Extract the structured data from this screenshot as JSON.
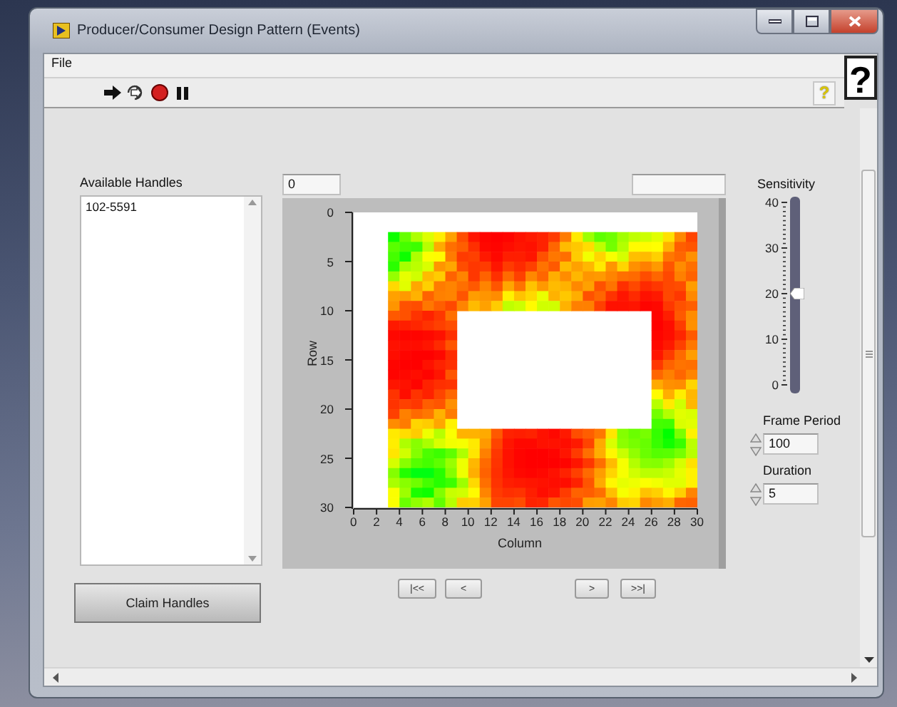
{
  "window": {
    "title": "Producer/Consumer Design Pattern (Events)"
  },
  "menu": [
    {
      "label": "File"
    }
  ],
  "toolbar": {
    "help_glyph": "?"
  },
  "context_help": {
    "glyph": "?"
  },
  "handles": {
    "label": "Available Handles",
    "items": [
      "102-5591"
    ],
    "button": "Claim Handles"
  },
  "frame_index": {
    "value": "0"
  },
  "graph": {
    "ylabel": "Row",
    "xlabel": "Column",
    "yticks": [
      "0",
      "5",
      "10",
      "15",
      "20",
      "25",
      "30"
    ],
    "xticks": [
      "0",
      "2",
      "4",
      "6",
      "8",
      "10",
      "12",
      "14",
      "16",
      "18",
      "20",
      "22",
      "24",
      "26",
      "28",
      "30"
    ]
  },
  "nav_buttons": [
    "|<<",
    "<",
    ">",
    ">>|"
  ],
  "sensitivity": {
    "label": "Sensitivity",
    "level": 0.5,
    "ticks": [
      "40",
      "30",
      "20",
      "10",
      "0"
    ]
  },
  "frame_period": {
    "label": "Frame Period",
    "value": "100"
  },
  "duration": {
    "label": "Duration",
    "value": "5"
  }
}
